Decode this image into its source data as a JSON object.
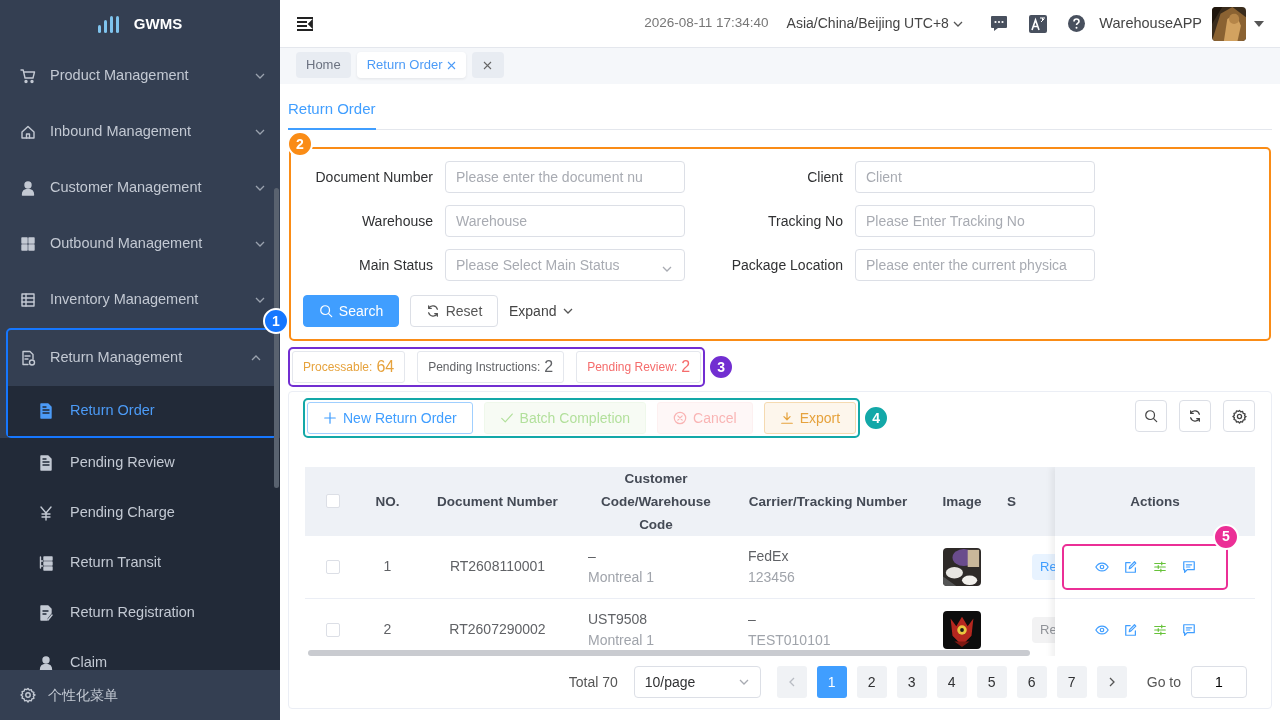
{
  "sidebar": {
    "logo": "GWMS",
    "items": [
      {
        "label": "Product Management",
        "expanded": false
      },
      {
        "label": "Inbound Management",
        "expanded": false
      },
      {
        "label": "Customer Management",
        "expanded": false
      },
      {
        "label": "Outbound Management",
        "expanded": false
      },
      {
        "label": "Inventory Management",
        "expanded": false
      },
      {
        "label": "Return Management",
        "expanded": true,
        "children": [
          {
            "label": "Return Order",
            "selected": true
          },
          {
            "label": "Pending Review",
            "selected": false
          },
          {
            "label": "Pending Charge",
            "selected": false
          },
          {
            "label": "Return Transit",
            "selected": false
          },
          {
            "label": "Return Registration",
            "selected": false
          },
          {
            "label": "Claim",
            "selected": false
          }
        ]
      }
    ],
    "footer": "个性化菜单"
  },
  "header": {
    "datetime": "2026-08-11 17:34:40",
    "timezone": "Asia/China/Beijing UTC+8",
    "user": "WarehouseAPP"
  },
  "tabs": [
    {
      "label": "Home",
      "selected": false,
      "closable": false
    },
    {
      "label": "Return Order",
      "selected": true,
      "closable": true
    }
  ],
  "page_tabs": [
    {
      "label": "Return Order",
      "selected": true
    }
  ],
  "filter": {
    "fields": [
      {
        "label": "Document Number",
        "placeholder": "Please enter the document nu",
        "kind": "input"
      },
      {
        "label": "Client",
        "placeholder": "Client",
        "kind": "input"
      },
      {
        "label": "Warehouse",
        "placeholder": "Warehouse",
        "kind": "input"
      },
      {
        "label": "Tracking No",
        "placeholder": "Please Enter Tracking No",
        "kind": "input"
      },
      {
        "label": "Main Status",
        "placeholder": "Please Select Main Status",
        "kind": "select"
      },
      {
        "label": "Package Location",
        "placeholder": "Please enter the current physica",
        "kind": "input"
      }
    ],
    "buttons": [
      {
        "label": "Search",
        "kind": "search"
      },
      {
        "label": "Reset",
        "kind": "reset"
      },
      {
        "label": "Expand",
        "kind": "expand"
      }
    ]
  },
  "stats": [
    {
      "label": "Processable:",
      "count": "64",
      "color": "#e6a23c"
    },
    {
      "label": "Pending Instructions:",
      "count": "2",
      "color": "#606266"
    },
    {
      "label": "Pending Review:",
      "count": "2",
      "color": "#f56c6c"
    }
  ],
  "toolbar": [
    {
      "label": "New Return Order",
      "kind": "new",
      "disabled": false
    },
    {
      "label": "Batch Completion",
      "kind": "complete",
      "disabled": true
    },
    {
      "label": "Cancel",
      "kind": "cancel",
      "disabled": true
    },
    {
      "label": "Export",
      "kind": "export",
      "disabled": false
    }
  ],
  "table": {
    "select_all": {
      "checked": false
    },
    "columns": [
      "NO.",
      "Document Number",
      "Customer Code/Warehouse Code",
      "Carrier/Tracking Number",
      "Image",
      "S",
      "Actions"
    ],
    "rows": [
      {
        "checked": false,
        "no": "1",
        "document_number": "RT2608110001",
        "customer_code": "–",
        "warehouse_code": "Montreal 1",
        "carrier": "FedEx",
        "tracking_number": "123456",
        "status": {
          "text": "Re",
          "color": "#409eff"
        }
      },
      {
        "checked": false,
        "no": "2",
        "document_number": "RT2607290002",
        "customer_code": "UST9508",
        "warehouse_code": "Montreal 1",
        "carrier": "–",
        "tracking_number": "TEST010101",
        "status": {
          "text": "Re",
          "color": "#909399"
        }
      }
    ]
  },
  "pagination": {
    "total": "Total 70",
    "page_size": "10/page",
    "pages": [
      {
        "label": "1",
        "selected": true
      },
      {
        "label": "2",
        "selected": false
      },
      {
        "label": "3",
        "selected": false
      },
      {
        "label": "4",
        "selected": false
      },
      {
        "label": "5",
        "selected": false
      },
      {
        "label": "6",
        "selected": false
      },
      {
        "label": "7",
        "selected": false
      }
    ],
    "goto_label": "Go to",
    "goto_value": "1"
  },
  "callouts": [
    {
      "number": "1",
      "color": "#1677ff"
    },
    {
      "number": "2",
      "color": "#fa8c16"
    },
    {
      "number": "3",
      "color": "#722ed1"
    },
    {
      "number": "4",
      "color": "#13a8a8"
    },
    {
      "number": "5",
      "color": "#eb2f96"
    }
  ]
}
